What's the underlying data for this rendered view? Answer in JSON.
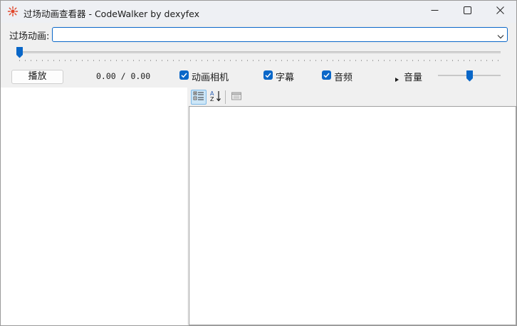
{
  "window": {
    "title": "过场动画查看器 - CodeWalker by dexyfex",
    "app_icon": "codewalker-sun-icon",
    "controls": [
      "minimize-icon",
      "maximize-icon",
      "close-icon"
    ]
  },
  "cutscene": {
    "label": "过场动画:",
    "selected_value": ""
  },
  "playback": {
    "play_label": "播放",
    "time": "0.00 / 0.00",
    "timeline_position": 0
  },
  "options": {
    "camera": {
      "label": "动画相机",
      "checked": true
    },
    "subtitles": {
      "label": "字幕",
      "checked": true
    },
    "audio": {
      "label": "音频",
      "checked": true
    }
  },
  "volume": {
    "label": "音量",
    "level": 0.5
  },
  "property_grid": {
    "toolbar": [
      "categorized-icon",
      "alphabetical-sort-icon",
      "property-pages-icon"
    ]
  },
  "colors": {
    "accent": "#0a67c8",
    "titlebar": "#eef0f4",
    "panel": "#ffffff",
    "background": "#f0f0f0"
  }
}
